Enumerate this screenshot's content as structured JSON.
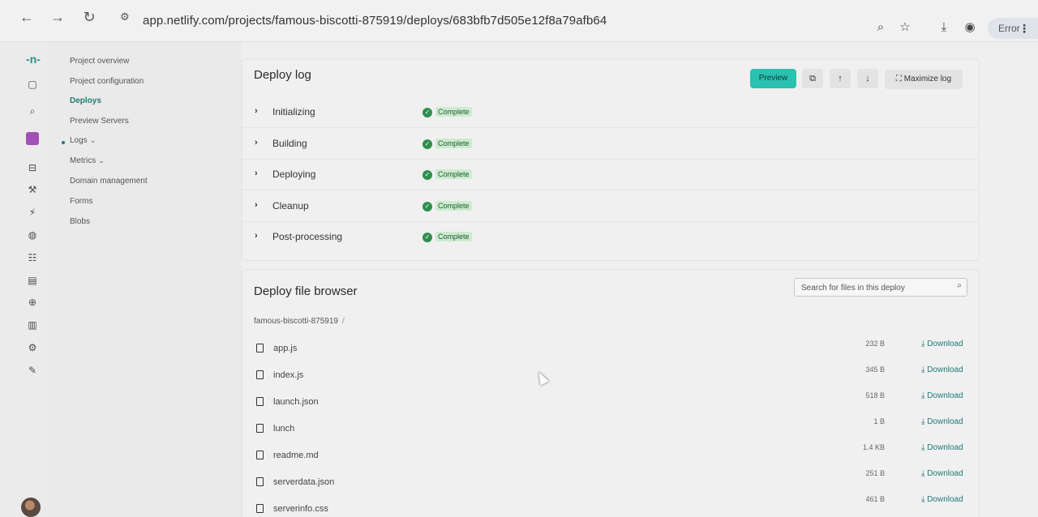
{
  "browser": {
    "url": "app.netlify.com/projects/famous-biscotti-875919/deploys/683bfb7d505e12f8a79afb64",
    "error_label": "Error"
  },
  "rail_icons": [
    "netlify-logo-icon",
    "panel-icon",
    "search-icon",
    "team-badge-icon",
    "package-icon",
    "build-icon",
    "plug-icon",
    "globe-icon",
    "people-icon",
    "billing-icon",
    "plus-circle-icon",
    "document-icon",
    "settings-icon",
    "edit-icon"
  ],
  "project_nav": [
    {
      "label": "Project overview"
    },
    {
      "label": "Project configuration"
    },
    {
      "label": "Deploys",
      "active": true
    },
    {
      "label": "Preview Servers"
    },
    {
      "label": "Logs",
      "chevron": "⌄"
    },
    {
      "label": "Metrics",
      "chevron": "⌄"
    },
    {
      "label": "Domain management"
    },
    {
      "label": "Forms"
    },
    {
      "label": "Blobs"
    }
  ],
  "deploy_log": {
    "title": "Deploy log",
    "preview_label": "Preview",
    "maximize_label": "Maximize log",
    "steps": [
      {
        "label": "Initializing",
        "status": "Complete"
      },
      {
        "label": "Building",
        "status": "Complete"
      },
      {
        "label": "Deploying",
        "status": "Complete"
      },
      {
        "label": "Cleanup",
        "status": "Complete"
      },
      {
        "label": "Post-processing",
        "status": "Complete"
      }
    ]
  },
  "file_browser": {
    "title": "Deploy file browser",
    "search_placeholder": "Search for files in this deploy",
    "breadcrumb": "famous-biscotti-875919",
    "breadcrumb_sep": "/",
    "download_label": "⤓ Download",
    "files": [
      {
        "name": "app.js",
        "size": "232 B"
      },
      {
        "name": "index.js",
        "size": "345 B"
      },
      {
        "name": "launch.json",
        "size": "518 B"
      },
      {
        "name": "lunch",
        "size": "1 B"
      },
      {
        "name": "readme.md",
        "size": "1.4 KB"
      },
      {
        "name": "serverdata.json",
        "size": "251 B"
      },
      {
        "name": "serverinfo.css",
        "size": "461 B"
      }
    ]
  },
  "colors": {
    "accent": "#2ac1b0",
    "active_nav": "#1f7a75",
    "complete_badge": "#cdebcf",
    "complete_check": "#2f8f4e"
  }
}
